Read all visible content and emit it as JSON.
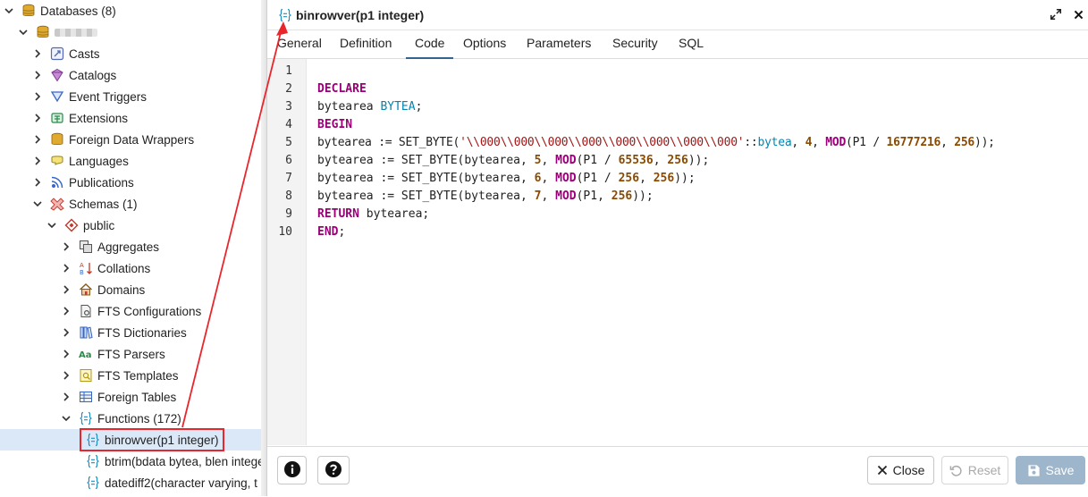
{
  "tree": {
    "databases": "Databases (8)",
    "casts": "Casts",
    "catalogs": "Catalogs",
    "event_triggers": "Event Triggers",
    "extensions": "Extensions",
    "fdw": "Foreign Data Wrappers",
    "languages": "Languages",
    "publications": "Publications",
    "schemas": "Schemas (1)",
    "public": "public",
    "aggregates": "Aggregates",
    "collations": "Collations",
    "domains": "Domains",
    "fts_configurations": "FTS Configurations",
    "fts_dictionaries": "FTS Dictionaries",
    "fts_parsers": "FTS Parsers",
    "fts_templates": "FTS Templates",
    "foreign_tables": "Foreign Tables",
    "functions": "Functions (172)",
    "func_binrowver": "binrowver(p1 integer)",
    "func_btrim": "btrim(bdata bytea, blen integer)",
    "func_datediff2": "datediff2(character varying, t"
  },
  "dialog": {
    "title": "binrowver(p1 integer)",
    "tabs": [
      "General",
      "Definition",
      "Code",
      "Options",
      "Parameters",
      "Security",
      "SQL"
    ],
    "active_tab": "Code",
    "line_numbers": [
      "1",
      "2",
      "3",
      "4",
      "5",
      "6",
      "7",
      "8",
      "9",
      "10"
    ],
    "footer": {
      "close": "Close",
      "reset": "Reset",
      "save": "Save"
    }
  },
  "code": {
    "l2_kw": "DECLARE",
    "l3_a": "bytearea ",
    "l3_type": "BYTEA",
    "l3_b": ";",
    "l4_kw": "BEGIN",
    "l5_a": "bytearea := SET_BYTE(",
    "l5_str": "'\\\\000\\\\000\\\\000\\\\000\\\\000\\\\000\\\\000\\\\000'",
    "l5_b": "::",
    "l5_type": "bytea",
    "l5_c": ", ",
    "l5_n1": "4",
    "l5_d": ", ",
    "l5_fn": "MOD",
    "l5_e": "(P1 / ",
    "l5_n2": "16777216",
    "l5_f": ", ",
    "l5_n3": "256",
    "l5_g": "));",
    "l6_a": "bytearea := SET_BYTE(bytearea, ",
    "l6_n1": "5",
    "l6_b": ", ",
    "l6_fn": "MOD",
    "l6_c": "(P1 / ",
    "l6_n2": "65536",
    "l6_d": ", ",
    "l6_n3": "256",
    "l6_e": "));",
    "l7_a": "bytearea := SET_BYTE(bytearea, ",
    "l7_n1": "6",
    "l7_b": ", ",
    "l7_fn": "MOD",
    "l7_c": "(P1 / ",
    "l7_n2": "256",
    "l7_d": ", ",
    "l7_n3": "256",
    "l7_e": "));",
    "l8_a": "bytearea := SET_BYTE(bytearea, ",
    "l8_n1": "7",
    "l8_b": ", ",
    "l8_fn": "MOD",
    "l8_c": "(P1, ",
    "l8_n2": "256",
    "l8_d": "));",
    "l9_kw": "RETURN",
    "l9_a": " bytearea;",
    "l10_kw": "END",
    "l10_a": ";"
  },
  "colors": {
    "annotation": "#e8262c",
    "keyword": "#990077",
    "type": "#0086b3",
    "string": "#a31515",
    "number": "#8b4a00",
    "selection": "#dbe8f7",
    "save_button": "#9eb6cc"
  },
  "icons": {
    "databases": "database-stack-icon",
    "casts": "cast-icon",
    "catalogs": "catalog-icon",
    "event_triggers": "event-trigger-icon",
    "extensions": "extension-icon",
    "fdw": "fdw-icon",
    "languages": "language-icon",
    "publications": "publication-icon",
    "schemas": "schema-icon",
    "public": "schema-diamond-icon",
    "function": "function-braces-icon"
  }
}
